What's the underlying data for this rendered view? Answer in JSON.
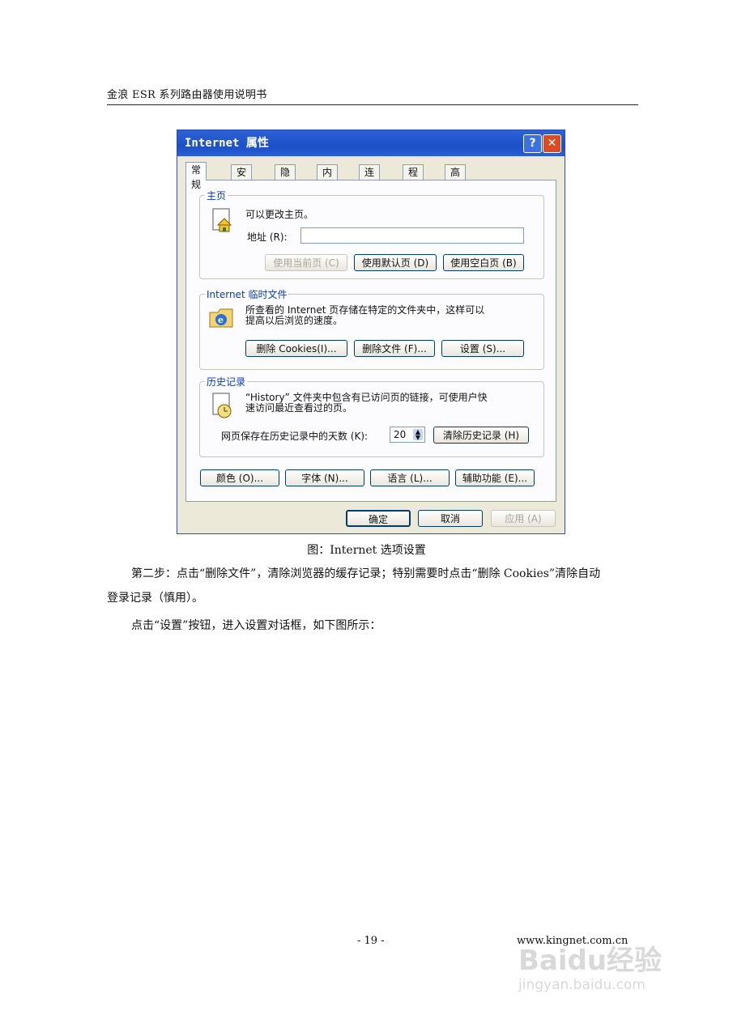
{
  "header": {
    "title": "金浪 ESR 系列路由器使用说明书"
  },
  "dialog": {
    "title": "Internet 属性",
    "help_label": "?",
    "close_label": "✕",
    "tabs": [
      "常规",
      "安全",
      "隐私",
      "内容",
      "连接",
      "程序",
      "高级"
    ],
    "home": {
      "group_title": "主页",
      "description": "可以更改主页。",
      "address_label": "地址 (R):",
      "address_value": "",
      "btn_current": "使用当前页 (C)",
      "btn_default": "使用默认页 (D)",
      "btn_blank": "使用空白页 (B)"
    },
    "temp": {
      "group_title": "Internet 临时文件",
      "desc_line1": "所查看的 Internet 页存储在特定的文件夹中，这样可以",
      "desc_line2": "提高以后浏览的速度。",
      "btn_cookies": "删除 Cookies(I)...",
      "btn_files": "删除文件 (F)...",
      "btn_settings": "设置 (S)..."
    },
    "history": {
      "group_title": "历史记录",
      "desc_line1": "“History” 文件夹中包含有已访问页的链接，可使用户快",
      "desc_line2": "速访问最近查看过的页。",
      "days_label": "网页保存在历史记录中的天数 (K):",
      "days_value": "20",
      "btn_clear": "清除历史记录 (H)"
    },
    "bottom_buttons": [
      "颜色 (O)...",
      "字体 (N)...",
      "语言 (L)...",
      "辅助功能 (E)..."
    ],
    "footer_buttons": {
      "ok": "确定",
      "cancel": "取消",
      "apply": "应用 (A)"
    }
  },
  "caption": "图：Internet 选项设置",
  "paragraphs": {
    "p1_line1": "第二步：点击“删除文件”，清除浏览器的缓存记录；特别需要时点击“删除 Cookies”清除自动",
    "p1_line2": "登录记录（慎用）。",
    "p2": "点击“设置”按钮，进入设置对话框，如下图所示："
  },
  "footer": {
    "page": "- 19 -",
    "url": "www.kingnet.com.cn"
  },
  "watermark": {
    "brand": "Baidu经验",
    "site": "jingyan.baidu.com"
  }
}
